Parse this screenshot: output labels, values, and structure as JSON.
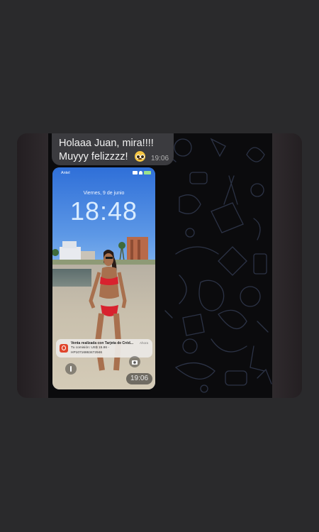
{
  "message": {
    "line1": "Holaaa Juan, mira!!!!",
    "line2": "Muyyy felizzzz!",
    "emoji_icon": "pleading-face-emoji",
    "time": "19:06"
  },
  "screenshot": {
    "carrier": "Antel",
    "date": "Viernes, 9 de junio",
    "time": "18:48",
    "notification": {
      "title": "Venta realizada con Tarjeta de Créd...",
      "when": "Ahora",
      "body_line1": "Tu comisión: US$ 15.86 -",
      "body_line2": "HP10716863472946",
      "icon": "hotmart-flame-icon"
    },
    "left_button_icon": "flashlight-icon",
    "right_button_icon": "camera-icon",
    "timestamp": "19:06"
  },
  "colors": {
    "page_bg": "#2a2a2c",
    "chat_bg": "#0b0b0d",
    "bubble_bg": "#3b3b3f",
    "doodle_stroke": "#2c3346"
  }
}
